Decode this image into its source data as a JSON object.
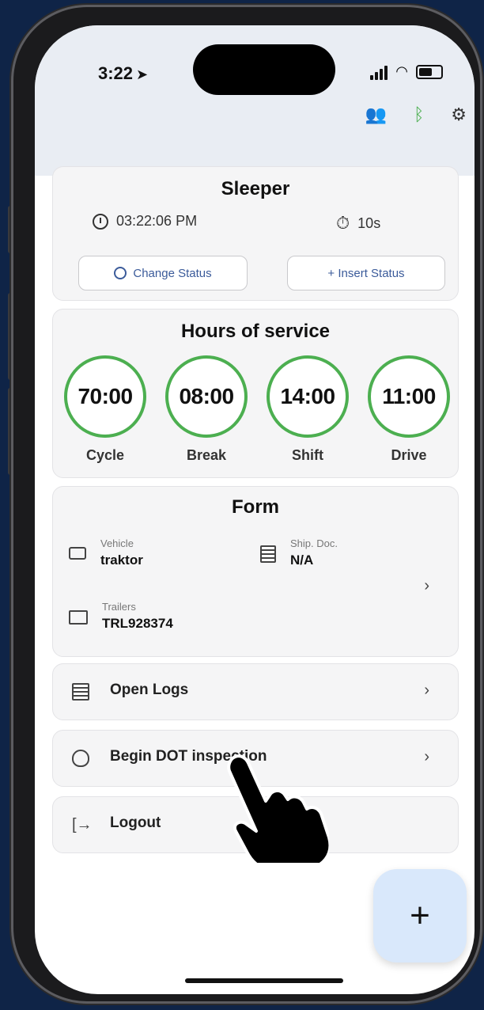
{
  "status_bar": {
    "time": "3:22"
  },
  "sleeper": {
    "title": "Sleeper",
    "clock_time": "03:22:06 PM",
    "timer": "10s",
    "change_status_label": "Change Status",
    "insert_status_label": "+ Insert Status"
  },
  "hours_of_service": {
    "title": "Hours of service",
    "items": [
      {
        "value": "70:00",
        "label": "Cycle"
      },
      {
        "value": "08:00",
        "label": "Break"
      },
      {
        "value": "14:00",
        "label": "Shift"
      },
      {
        "value": "11:00",
        "label": "Drive"
      }
    ]
  },
  "form": {
    "title": "Form",
    "vehicle_label": "Vehicle",
    "vehicle_value": "traktor",
    "ship_doc_label": "Ship. Doc.",
    "ship_doc_value": "N/A",
    "trailers_label": "Trailers",
    "trailers_value": "TRL928374"
  },
  "menu": {
    "open_logs": "Open Logs",
    "dot_inspection": "Begin DOT inspection",
    "logout": "Logout"
  },
  "fab_label": "+",
  "colors": {
    "background": "#0f2447",
    "ring_green": "#4caf50",
    "accent_blue": "#3b5b9a",
    "fab_bg": "#d9e8fb"
  }
}
